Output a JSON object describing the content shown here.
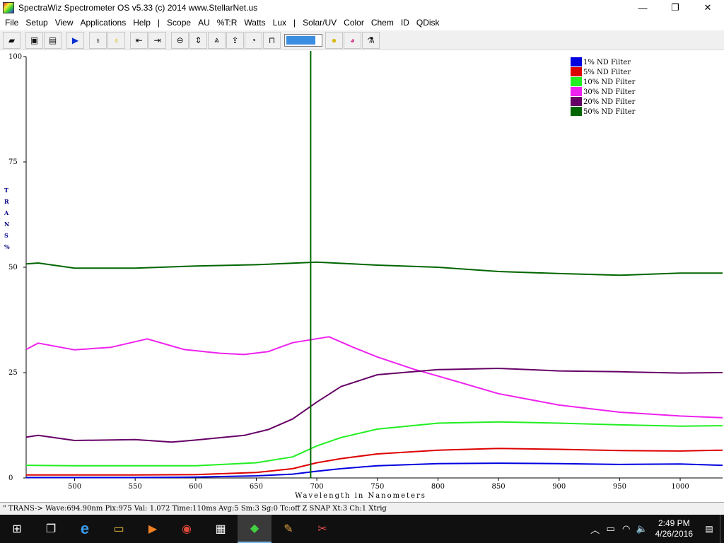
{
  "window": {
    "title": "SpectraWiz  Spectrometer OS v5.33 (c) 2014    www.StellarNet.us",
    "minimize": "—",
    "maximize": "❐",
    "close": "✕"
  },
  "menu": [
    "File",
    "Setup",
    "View",
    "Applications",
    "Help",
    "|",
    "Scope",
    "AU",
    "%T:R",
    "Watts",
    "Lux",
    "|",
    "Solar/UV",
    "Color",
    "Chem",
    "ID",
    "QDisk"
  ],
  "toolbar": {
    "buttons": [
      {
        "name": "open-icon",
        "glyph": "▰"
      },
      {
        "name": "save-icon",
        "glyph": "▣"
      },
      {
        "name": "print-icon",
        "glyph": "▤"
      },
      {
        "name": "play-icon",
        "glyph": "▶"
      },
      {
        "name": "bulb-dark-icon",
        "glyph": "♁"
      },
      {
        "name": "bulb-light-icon",
        "glyph": "♁"
      },
      {
        "name": "cursor-left-icon",
        "glyph": "⇤"
      },
      {
        "name": "cursor-right-icon",
        "glyph": "⇥"
      },
      {
        "name": "zoom-icon",
        "glyph": "⊖"
      },
      {
        "name": "autoscale-y-icon",
        "glyph": "⇕"
      },
      {
        "name": "peak-icon",
        "glyph": "⩓"
      },
      {
        "name": "scale-up-icon",
        "glyph": "⇪"
      },
      {
        "name": "gauge-icon",
        "glyph": "◔"
      },
      {
        "name": "bracket-icon",
        "glyph": "⊓"
      }
    ],
    "buttons_after": [
      {
        "name": "sun-icon",
        "glyph": "●"
      },
      {
        "name": "color-wheel-icon",
        "glyph": "◕"
      },
      {
        "name": "chem-icon",
        "glyph": "⚗"
      }
    ],
    "slider_level": 0.85
  },
  "chart_data": {
    "type": "line",
    "ylabel": "TRANS%",
    "xlabel": "Wavelength in Nanometers",
    "xlim": [
      460,
      1035
    ],
    "ylim": [
      0,
      100
    ],
    "xticks": [
      500,
      550,
      600,
      650,
      700,
      750,
      800,
      850,
      900,
      950,
      1000
    ],
    "yticks": [
      0,
      25,
      50,
      75,
      100
    ],
    "grid": false,
    "legend_position": "top-right",
    "cursor_wavelength": 694.9,
    "series": [
      {
        "name": "1% ND Filter",
        "color": "#0000e0",
        "points": [
          [
            460,
            0.1
          ],
          [
            500,
            0.1
          ],
          [
            550,
            0.1
          ],
          [
            600,
            0.2
          ],
          [
            650,
            0.5
          ],
          [
            680,
            0.9
          ],
          [
            700,
            1.6
          ],
          [
            720,
            2.2
          ],
          [
            750,
            2.9
          ],
          [
            800,
            3.4
          ],
          [
            850,
            3.5
          ],
          [
            900,
            3.4
          ],
          [
            950,
            3.2
          ],
          [
            1000,
            3.3
          ],
          [
            1035,
            3.0
          ]
        ]
      },
      {
        "name": "5% ND Filter",
        "color": "#dd0000",
        "points": [
          [
            460,
            0.7
          ],
          [
            500,
            0.7
          ],
          [
            550,
            0.7
          ],
          [
            600,
            0.8
          ],
          [
            650,
            1.3
          ],
          [
            680,
            2.2
          ],
          [
            700,
            3.6
          ],
          [
            720,
            4.6
          ],
          [
            750,
            5.7
          ],
          [
            800,
            6.6
          ],
          [
            850,
            7.0
          ],
          [
            900,
            6.8
          ],
          [
            950,
            6.5
          ],
          [
            1000,
            6.4
          ],
          [
            1035,
            6.6
          ]
        ]
      },
      {
        "name": "10% ND Filter",
        "color": "#22ee22",
        "points": [
          [
            460,
            3.0
          ],
          [
            500,
            2.9
          ],
          [
            550,
            2.9
          ],
          [
            600,
            2.9
          ],
          [
            650,
            3.6
          ],
          [
            680,
            5.0
          ],
          [
            700,
            7.6
          ],
          [
            720,
            9.6
          ],
          [
            750,
            11.6
          ],
          [
            800,
            13.0
          ],
          [
            850,
            13.3
          ],
          [
            900,
            13.0
          ],
          [
            950,
            12.6
          ],
          [
            1000,
            12.3
          ],
          [
            1035,
            12.4
          ]
        ]
      },
      {
        "name": "30% ND Filter",
        "color": "#ee22ee",
        "points": [
          [
            460,
            30.5
          ],
          [
            470,
            32.0
          ],
          [
            500,
            30.4
          ],
          [
            530,
            31.0
          ],
          [
            560,
            33.0
          ],
          [
            590,
            30.5
          ],
          [
            620,
            29.6
          ],
          [
            640,
            29.3
          ],
          [
            660,
            30.0
          ],
          [
            680,
            32.1
          ],
          [
            710,
            33.5
          ],
          [
            730,
            31.0
          ],
          [
            750,
            28.7
          ],
          [
            780,
            25.8
          ],
          [
            800,
            24.2
          ],
          [
            850,
            20.0
          ],
          [
            900,
            17.3
          ],
          [
            950,
            15.6
          ],
          [
            1000,
            14.7
          ],
          [
            1035,
            14.3
          ]
        ]
      },
      {
        "name": "20% ND Filter",
        "color": "#660066",
        "points": [
          [
            460,
            9.7
          ],
          [
            470,
            10.1
          ],
          [
            500,
            8.9
          ],
          [
            550,
            9.1
          ],
          [
            580,
            8.5
          ],
          [
            600,
            9.0
          ],
          [
            640,
            10.1
          ],
          [
            660,
            11.5
          ],
          [
            680,
            14.0
          ],
          [
            700,
            18.0
          ],
          [
            720,
            21.7
          ],
          [
            750,
            24.5
          ],
          [
            800,
            25.7
          ],
          [
            850,
            26.0
          ],
          [
            900,
            25.4
          ],
          [
            950,
            25.2
          ],
          [
            1000,
            24.9
          ],
          [
            1035,
            25.0
          ]
        ]
      },
      {
        "name": "50% ND Filter",
        "color": "#006600",
        "points": [
          [
            460,
            50.8
          ],
          [
            470,
            51.0
          ],
          [
            500,
            49.8
          ],
          [
            550,
            49.8
          ],
          [
            600,
            50.3
          ],
          [
            650,
            50.6
          ],
          [
            700,
            51.2
          ],
          [
            750,
            50.5
          ],
          [
            800,
            50.0
          ],
          [
            850,
            49.0
          ],
          [
            900,
            48.5
          ],
          [
            950,
            48.1
          ],
          [
            1000,
            48.6
          ],
          [
            1035,
            48.6
          ]
        ]
      }
    ]
  },
  "status": {
    "text": "\" TRANS->  Wave:694.90nm  Pix:975  Val:  1.072  Time:110ms  Avg:5  Sm:3  Sg:0  Tc:off  Z  SNAP  Xt:3  Ch:1  Xtrig"
  },
  "taskbar": {
    "apps": [
      {
        "name": "windows-start-icon",
        "glyph": "⊞",
        "active": false
      },
      {
        "name": "task-view-icon",
        "glyph": "❐",
        "active": false
      },
      {
        "name": "edge-icon",
        "glyph": "e",
        "active": false
      },
      {
        "name": "file-explorer-icon",
        "glyph": "▭",
        "active": false
      },
      {
        "name": "media-player-icon",
        "glyph": "▶",
        "active": false
      },
      {
        "name": "chrome-icon",
        "glyph": "◉",
        "active": false
      },
      {
        "name": "calculator-icon",
        "glyph": "▦",
        "active": false
      },
      {
        "name": "spectrawiz-icon",
        "glyph": "◆",
        "active": true
      },
      {
        "name": "paint-icon",
        "glyph": "✎",
        "active": false
      },
      {
        "name": "snipping-icon",
        "glyph": "✂",
        "active": false
      }
    ],
    "tray": [
      {
        "name": "chevron-up-icon",
        "glyph": "︿"
      },
      {
        "name": "battery-icon",
        "glyph": "▭"
      },
      {
        "name": "wifi-icon",
        "glyph": "◠"
      },
      {
        "name": "volume-icon",
        "glyph": "🔈"
      }
    ],
    "time": "2:49 PM",
    "date": "4/26/2016"
  }
}
